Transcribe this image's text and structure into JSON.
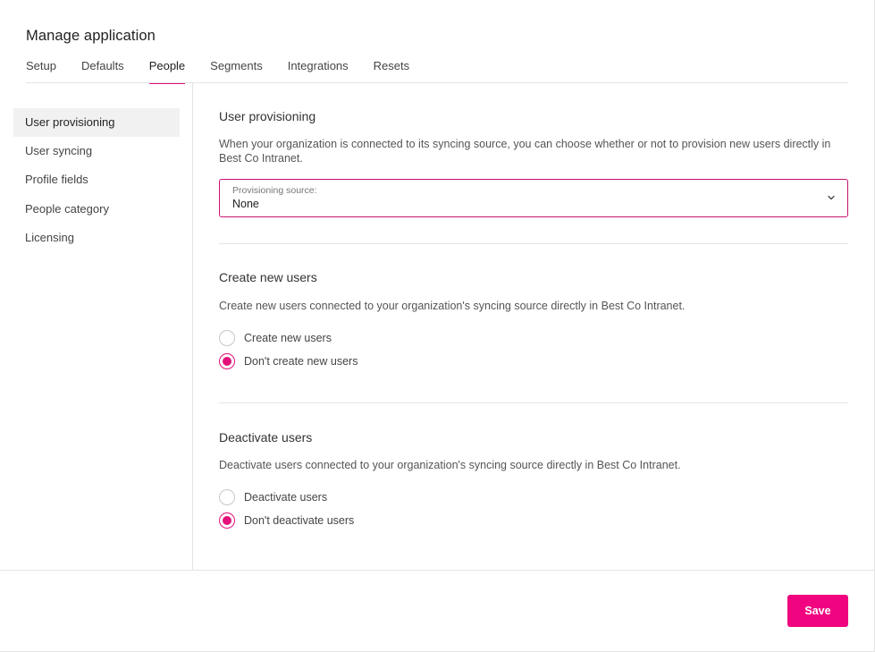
{
  "header": {
    "title": "Manage application"
  },
  "tabs": [
    {
      "label": "Setup"
    },
    {
      "label": "Defaults"
    },
    {
      "label": "People"
    },
    {
      "label": "Segments"
    },
    {
      "label": "Integrations"
    },
    {
      "label": "Resets"
    }
  ],
  "active_tab": "People",
  "sidebar": {
    "items": [
      {
        "label": "User provisioning"
      },
      {
        "label": "User syncing"
      },
      {
        "label": "Profile fields"
      },
      {
        "label": "People category"
      },
      {
        "label": "Licensing"
      }
    ],
    "active_item": "User provisioning"
  },
  "provisioning": {
    "title": "User provisioning",
    "description": "When your organization is connected to its syncing source, you can choose whether or not to provision new users directly in Best Co Intranet.",
    "select_label": "Provisioning source:",
    "select_value": "None"
  },
  "create_users": {
    "title": "Create new users",
    "description": "Create new users connected to your organization's syncing source directly in Best Co Intranet.",
    "options": [
      {
        "label": "Create new users",
        "checked": false
      },
      {
        "label": "Don't create new users",
        "checked": true
      }
    ]
  },
  "deactivate_users": {
    "title": "Deactivate users",
    "description": "Deactivate users connected to your organization's syncing source directly in Best Co Intranet.",
    "options": [
      {
        "label": "Deactivate users",
        "checked": false
      },
      {
        "label": "Don't deactivate users",
        "checked": true
      }
    ]
  },
  "footer": {
    "save_label": "Save"
  },
  "colors": {
    "accent": "#f0047f",
    "accent_border": "#c8106e",
    "divider": "#e4e4e4",
    "active_bg": "#f1f1f1"
  },
  "icons": {
    "select_chevron": "chevron-down-icon"
  }
}
